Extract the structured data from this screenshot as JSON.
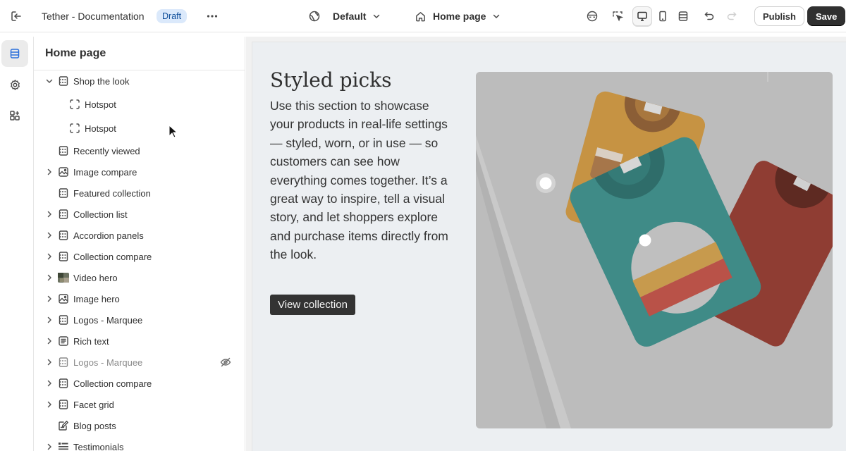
{
  "topbar": {
    "store_title": "Tether - Documentation",
    "status_badge": "Draft",
    "theme_selector": "Default",
    "page_selector": "Home page",
    "publish_label": "Publish",
    "save_label": "Save"
  },
  "sidebar": {
    "title": "Home page",
    "items": [
      {
        "label": "Shop the look",
        "icon": "section-icon",
        "expandable": "open"
      },
      {
        "label": "Hotspot",
        "icon": "hotspot-icon"
      },
      {
        "label": "Hotspot",
        "icon": "hotspot-icon"
      },
      {
        "label": "Recently viewed",
        "icon": "section-icon"
      },
      {
        "label": "Image compare",
        "icon": "image-icon",
        "expandable": "closed"
      },
      {
        "label": "Featured collection",
        "icon": "section-icon"
      },
      {
        "label": "Collection list",
        "icon": "section-icon",
        "expandable": "closed"
      },
      {
        "label": "Accordion panels",
        "icon": "section-icon",
        "expandable": "closed"
      },
      {
        "label": "Collection compare",
        "icon": "section-icon",
        "expandable": "closed"
      },
      {
        "label": "Video hero",
        "icon": "video-thumbnail",
        "expandable": "closed"
      },
      {
        "label": "Image hero",
        "icon": "image-icon",
        "expandable": "closed"
      },
      {
        "label": "Logos - Marquee",
        "icon": "section-icon",
        "expandable": "closed"
      },
      {
        "label": "Rich text",
        "icon": "text-icon",
        "expandable": "closed"
      },
      {
        "label": "Logos - Marquee",
        "icon": "section-icon",
        "expandable": "closed",
        "hidden": true
      },
      {
        "label": "Collection compare",
        "icon": "section-icon",
        "expandable": "closed"
      },
      {
        "label": "Facet grid",
        "icon": "section-icon",
        "expandable": "closed"
      },
      {
        "label": "Blog posts",
        "icon": "blog-icon"
      },
      {
        "label": "Testimonials",
        "icon": "testimonials-icon",
        "expandable": "closed"
      }
    ]
  },
  "preview": {
    "heading": "Styled picks",
    "body": "Use this section to showcase your products in real-life settings — styled, worn, or in use — so customers can see how everything comes together. It’s a great way to inspire, tell a visual story, and let shoppers explore and purchase items directly from the look.",
    "cta_label": "View collection"
  },
  "colors": {
    "accent": "#2a6fdb",
    "save_button": "#303030",
    "badge_bg": "#dbe9fb",
    "preview_bg": "#eceff2",
    "shirt_mustard": "#c99446",
    "shirt_teal": "#3f8b87",
    "shirt_rust": "#8f3d33"
  }
}
